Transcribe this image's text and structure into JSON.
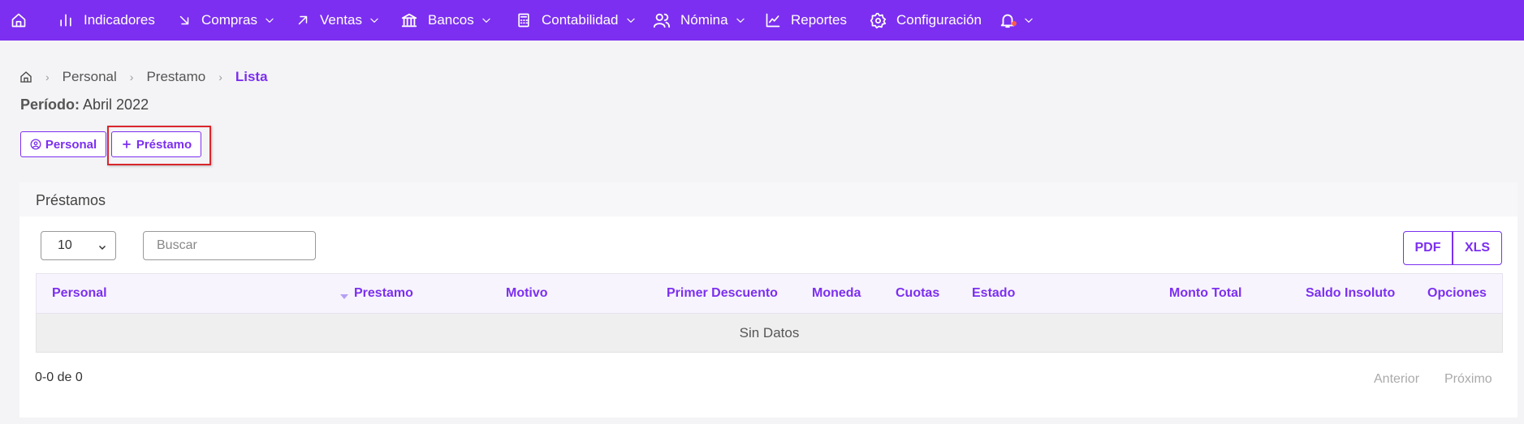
{
  "nav": {
    "items": [
      {
        "label": "Indicadores",
        "chevron": false
      },
      {
        "label": "Compras",
        "chevron": true
      },
      {
        "label": "Ventas",
        "chevron": true
      },
      {
        "label": "Bancos",
        "chevron": true
      },
      {
        "label": "Contabilidad",
        "chevron": true
      },
      {
        "label": "Nómina",
        "chevron": true
      },
      {
        "label": "Reportes",
        "chevron": false
      },
      {
        "label": "Configuración",
        "chevron": false
      }
    ],
    "accent": "#7c2ff0"
  },
  "breadcrumb": {
    "items": [
      "Personal",
      "Prestamo"
    ],
    "active": "Lista"
  },
  "periodo": {
    "label": "Período:",
    "value": "Abril 2022"
  },
  "actions": {
    "personal_label": "Personal",
    "prestamo_label": "Préstamo"
  },
  "card": {
    "title": "Préstamos",
    "page_size": "10",
    "search_placeholder": "Buscar",
    "export_pdf": "PDF",
    "export_xls": "XLS"
  },
  "table": {
    "columns": [
      "Personal",
      "Prestamo",
      "Motivo",
      "Primer Descuento",
      "Moneda",
      "Cuotas",
      "Estado",
      "Monto Total",
      "Saldo Insoluto",
      "Opciones"
    ],
    "empty_text": "Sin Datos"
  },
  "pagination": {
    "info": "0-0 de 0",
    "prev": "Anterior",
    "next": "Próximo"
  },
  "colors": {
    "highlight": "#d9262c",
    "notification_dot": "#ff5a4f"
  }
}
